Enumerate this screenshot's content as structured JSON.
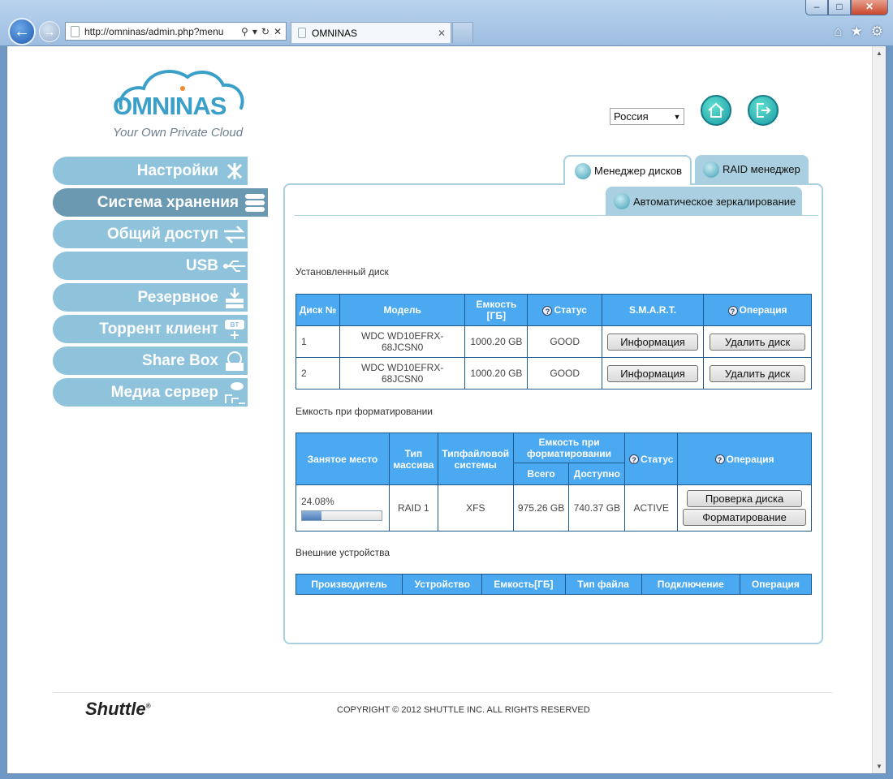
{
  "browser": {
    "url": "http://omninas/admin.php?menu",
    "tab_title": "OMNINAS"
  },
  "header": {
    "logo_text": "OMNINAS",
    "logo_tagline": "Your Own Private Cloud",
    "language": "Россия"
  },
  "nav": {
    "items": [
      {
        "label": "Настройки",
        "icon": "tools-icon"
      },
      {
        "label": "Система хранения",
        "icon": "storage-icon"
      },
      {
        "label": "Общий доступ",
        "icon": "share-arrows-icon"
      },
      {
        "label": "USB",
        "icon": "usb-icon"
      },
      {
        "label": "Резервное",
        "icon": "backup-icon"
      },
      {
        "label": "Торрент клиент",
        "icon": "bittorrent-icon"
      },
      {
        "label": "Share Box",
        "icon": "sharebox-icon"
      },
      {
        "label": "Медиа сервер",
        "icon": "media-server-icon"
      }
    ]
  },
  "tabs": {
    "disk_manager": "Менеджер дисков",
    "raid_manager": "RAID менеджер",
    "auto_mirror": "Автоматическое зеркалирование"
  },
  "installed": {
    "title": "Установленный диск",
    "headers": [
      "Диск №",
      "Модель",
      "Емкость [ГБ]",
      "Статус",
      "S.M.A.R.T.",
      "Операция"
    ],
    "rows": [
      {
        "num": "1",
        "model": "WDC WD10EFRX-68JCSN0",
        "capacity": "1000.20 GB",
        "status": "GOOD",
        "smart_btn": "Информация",
        "op_btn": "Удалить диск"
      },
      {
        "num": "2",
        "model": "WDC WD10EFRX-68JCSN0",
        "capacity": "1000.20 GB",
        "status": "GOOD",
        "smart_btn": "Информация",
        "op_btn": "Удалить диск"
      }
    ]
  },
  "formatted": {
    "title": "Емкость при форматировании",
    "headers": {
      "used": "Занятое место",
      "array_type": "Тип массива",
      "fs_type": "Типфайловой системы",
      "capacity": "Емкость при форматировании",
      "total": "Всего",
      "available": "Доступно",
      "status": "Статус",
      "operation": "Операция"
    },
    "row": {
      "used_pct": "24.08%",
      "used_fraction": 0.2408,
      "array_type": "RAID 1",
      "fs_type": "XFS",
      "total": "975.26 GB",
      "available": "740.37 GB",
      "status": "ACTIVE",
      "check_btn": "Проверка диска",
      "format_btn": "Форматирование"
    }
  },
  "external": {
    "title": "Внешние устройства",
    "headers": [
      "Производитель",
      "Устройство",
      "Емкость[ГБ]",
      "Тип файла",
      "Подключение",
      "Операция"
    ]
  },
  "footer": {
    "brand": "Shuttle",
    "copyright": "COPYRIGHT © 2012 SHUTTLE INC. ALL RIGHTS RESERVED"
  },
  "colors": {
    "table_header": "#4aa9f0",
    "nav_item": "#8fc3dc",
    "nav_active": "#6b99b2",
    "accent": "#3ba0c9"
  }
}
